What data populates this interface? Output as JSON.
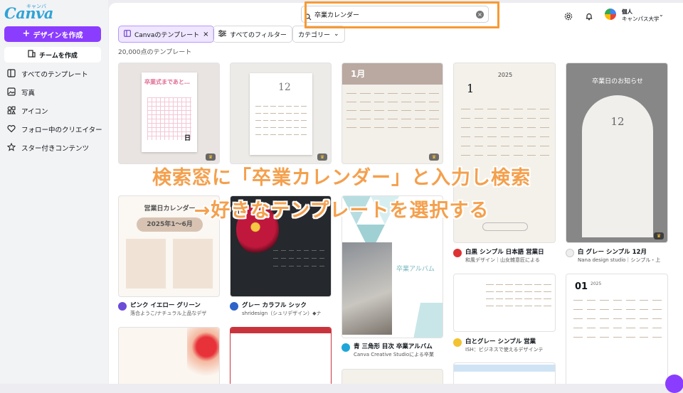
{
  "sidebar": {
    "logo": "Canva",
    "logo_kana": "キャンバ",
    "create_label": "デザインを作成",
    "team_label": "チームを作成",
    "nav": [
      {
        "label": "すべてのテンプレート",
        "icon": "template-icon"
      },
      {
        "label": "写真",
        "icon": "photo-icon"
      },
      {
        "label": "アイコン",
        "icon": "shapes-icon"
      },
      {
        "label": "フォロー中のクリエイター",
        "icon": "heart-icon"
      },
      {
        "label": "スター付きコンテンツ",
        "icon": "star-icon"
      }
    ]
  },
  "header": {
    "search_value": "卒業カレンダー",
    "account_name": "個人",
    "account_org": "キャンパス大学"
  },
  "filters": {
    "active_chip": "Canvaのテンプレート",
    "all_filters": "すべてのフィルター",
    "category": "カテゴリー"
  },
  "result_count": "20,000点のテンプレート",
  "cards": {
    "c2_title": "グレー カラフル シック",
    "c2_author": "shridesign（シュリデザイン）◆ナ",
    "c1_title": "ピンク イエロー グリーン",
    "c1_author": "落合ようこ/ナチュラル上品なデザ",
    "c3_title": "青 三角形 目次 卒業アルバム",
    "c3_author": "Canva Creative Studioによる卒業",
    "c3_thumb_text": "卒業アルバム",
    "c4_title": "白黒 シンプル 日本語 営業日",
    "c4_author": "和風デザイン｜山女雑意匠による",
    "c4_thumb_year": "2025",
    "c4_thumb_month": "1",
    "c5_title": "白 グレー シンプル 12月",
    "c5_author": "Nana design studio｜シンプル・上",
    "c5_thumb_title": "卒業日のお知らせ",
    "c5_thumb_month": "12",
    "c6_title": "白とグレー シンプル 営業",
    "c6_author": "ISH：ビジネスで使えるデザインテ",
    "r2c1_thumb_title": "営業日カレンダー",
    "r2c1_thumb_range": "2025年1〜6月",
    "r1c3_thumb_month": "1月",
    "r1c2_thumb_month": "12",
    "r1c1_thumb_text": "卒業式まであと…",
    "r1c1_thumb_day": "日",
    "c5b_thumb_month": "01",
    "c5b_thumb_year": "2025"
  },
  "overlay": {
    "line1": "検索窓に「卒業カレンダー」と入力し検索",
    "line2": "→好きなテンプレートを選択する"
  },
  "colors": {
    "accent": "#8b3dff",
    "overlay_text": "#f4a04d",
    "highlight_box": "#f79a33"
  }
}
